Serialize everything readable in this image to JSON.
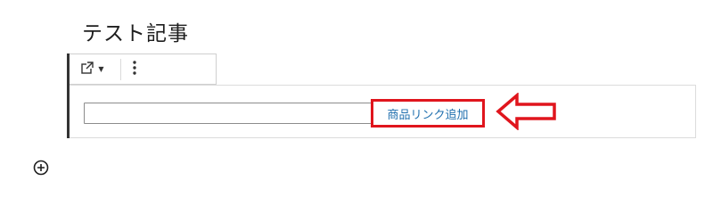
{
  "post": {
    "title": "テスト記事"
  },
  "toolbar": {
    "link_icon": "external-link-icon",
    "dropdown_icon": "caret-down-icon",
    "more_icon": "more-vertical-icon"
  },
  "link_block": {
    "url_value": "",
    "url_placeholder": "",
    "add_button_label": "商品リンク追加"
  },
  "annotation": {
    "highlight_color": "#e0151d",
    "arrow_icon": "left-arrow-icon"
  },
  "inserter": {
    "icon": "plus-circle-icon"
  },
  "colors": {
    "link_text": "#1f6fae",
    "highlight": "#e0151d"
  }
}
